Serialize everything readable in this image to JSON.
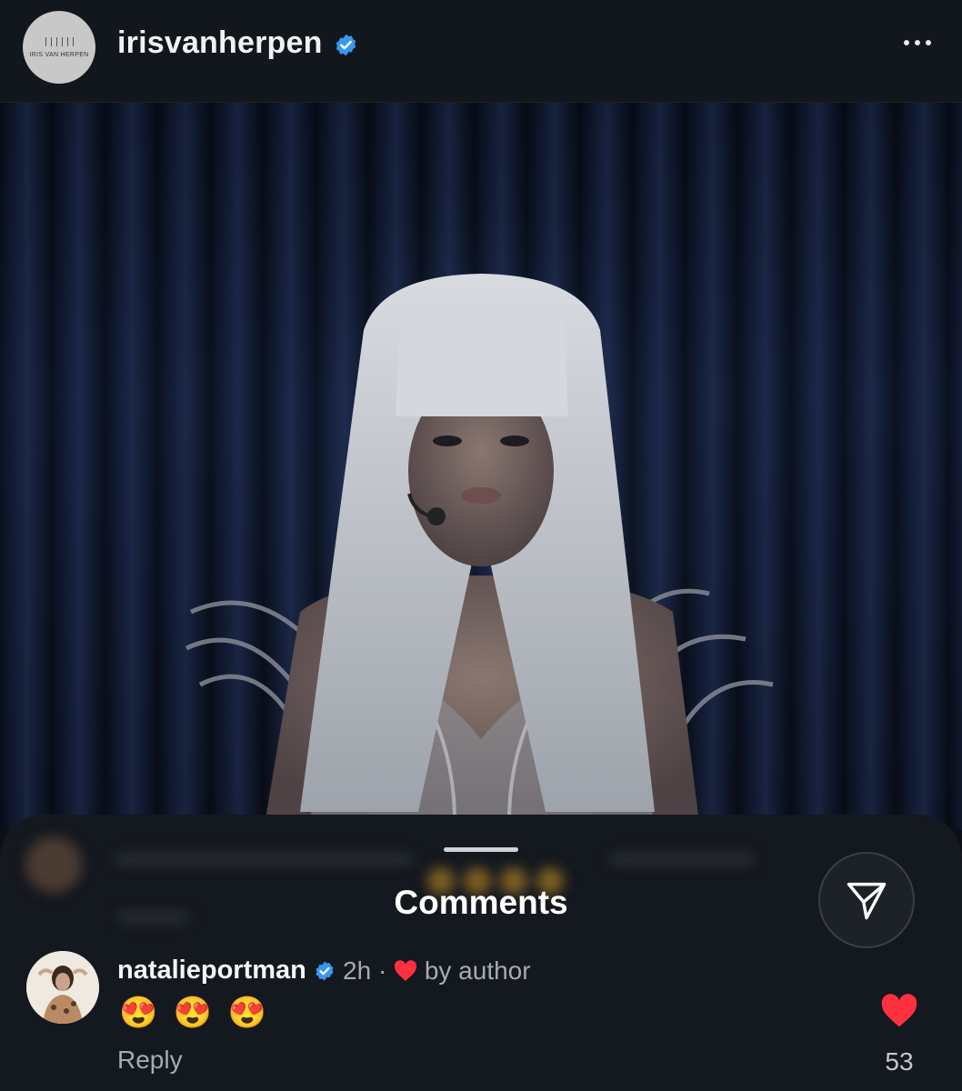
{
  "header": {
    "username": "irisvanherpen",
    "brand_logo_text": "IRIS VAN HERPEN",
    "verified": true,
    "more_icon": "ellipsis-icon"
  },
  "post": {
    "image_alt": ""
  },
  "comments_sheet": {
    "title": "Comments",
    "share_icon": "paper-plane-icon",
    "comment": {
      "username": "natalieportman",
      "verified": true,
      "time": "2h",
      "separator": "·",
      "liked_by": "by author",
      "emojis": [
        "😍",
        "😍",
        "😍"
      ],
      "reply_label": "Reply",
      "like_count": "53"
    }
  },
  "colors": {
    "verified_blue": "#3897f0",
    "heart_red": "#ff3040",
    "background": "#0c0f15"
  }
}
